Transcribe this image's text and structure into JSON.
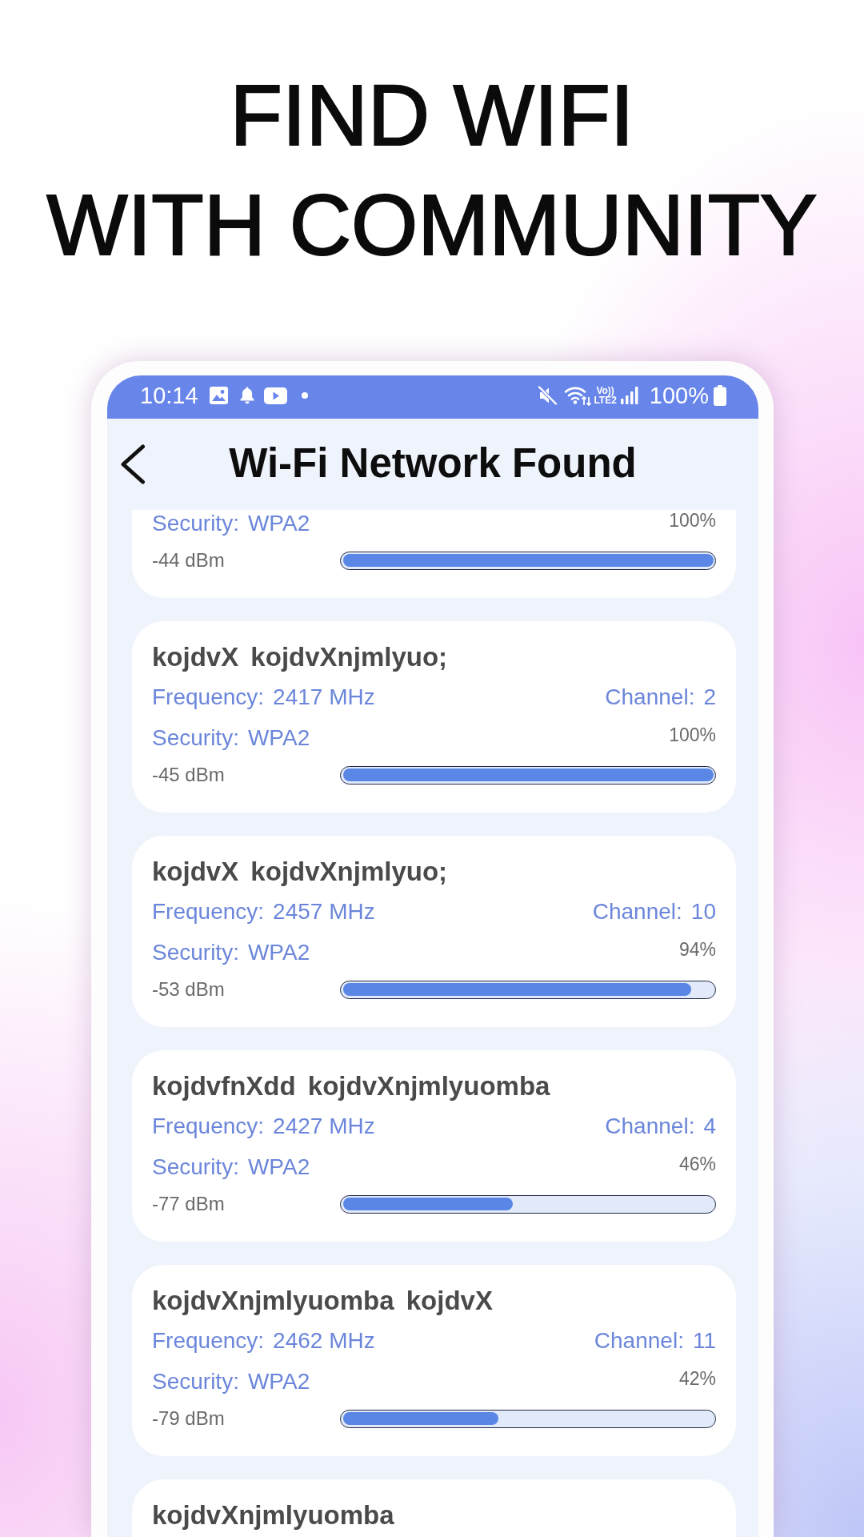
{
  "headline": [
    "FIND WIFI",
    "WITH COMMUNITY"
  ],
  "status_bar": {
    "time": "10:14",
    "network_type": [
      "Vo))",
      "LTE2"
    ],
    "battery": "100%"
  },
  "app_bar": {
    "title": "Wi-Fi Network Found"
  },
  "networks": [
    {
      "security_label": "Security:",
      "security": "WPA2",
      "percent": "100%",
      "signal": "-44 dBm",
      "level": 1
    },
    {
      "name": "kojdvX kojdvXnjmlyuo;",
      "frequency_label": "Frequency:",
      "frequency": "2417 MHz",
      "channel_label": "Channel:",
      "channel": "2",
      "security_label": "Security:",
      "security": "WPA2",
      "percent": "100%",
      "signal": "-45 dBm",
      "level": 1
    },
    {
      "name": "kojdvX kojdvXnjmlyuo;",
      "frequency_label": "Frequency:",
      "frequency": "2457 MHz",
      "channel_label": "Channel:",
      "channel": "10",
      "security_label": "Security:",
      "security": "WPA2",
      "percent": "94%",
      "signal": "-53 dBm",
      "level": 0.94
    },
    {
      "name": "kojdvfnXdd kojdvXnjmlyuomba",
      "frequency_label": "Frequency:",
      "frequency": "2427 MHz",
      "channel_label": "Channel:",
      "channel": "4",
      "security_label": "Security:",
      "security": "WPA2",
      "percent": "46%",
      "signal": "-77 dBm",
      "level": 0.46
    },
    {
      "name": "kojdvXnjmlyuomba kojdvX",
      "frequency_label": "Frequency:",
      "frequency": "2462 MHz",
      "channel_label": "Channel:",
      "channel": "11",
      "security_label": "Security:",
      "security": "WPA2",
      "percent": "42%",
      "signal": "-79 dBm",
      "level": 0.42
    },
    {
      "name": "kojdvXnjmlyuomba"
    }
  ]
}
